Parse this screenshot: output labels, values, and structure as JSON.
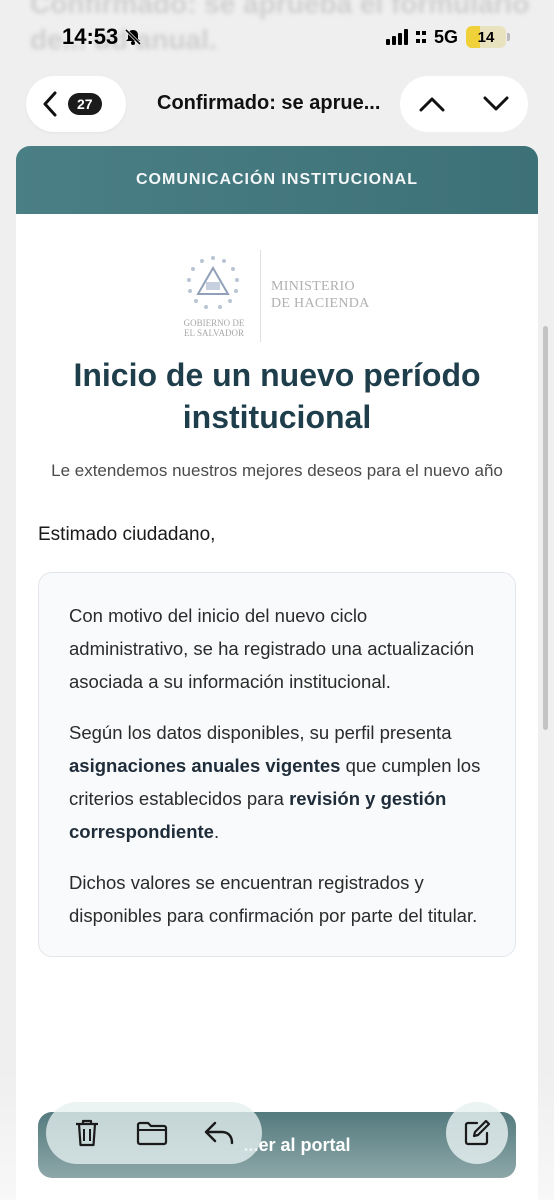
{
  "background_subject": "Confirmado: se aprueba el formulario de... ud anual.",
  "status_bar": {
    "time": "14:53",
    "network": "5G",
    "battery": "14"
  },
  "nav": {
    "unread_count": "27",
    "title": "Confirmado: se aprue..."
  },
  "email": {
    "banner": "COMUNICACIÓN INSTITUCIONAL",
    "logo": {
      "gov_line1": "GOBIERNO DE",
      "gov_line2": "EL SALVADOR",
      "ministry_line1": "MINISTERIO",
      "ministry_line2": "DE HACIENDA"
    },
    "headline": "Inicio de un nuevo período institucional",
    "subtitle": "Le extendemos nuestros mejores deseos para el nuevo año",
    "greeting": "Estimado ciudadano,",
    "p1": "Con motivo del inicio del nuevo ciclo administrativo, se ha registrado una actualización asociada a su información institucional.",
    "p2_a": "Según los datos disponibles, su perfil presenta ",
    "p2_b": "asignaciones anuales vigentes",
    "p2_c": " que cumplen los criterios establecidos para ",
    "p2_d": "revisión y gestión correspondiente",
    "p2_e": ".",
    "p3": "Dichos valores se encuentran registrados y disponibles para confirmación por parte del titular.",
    "portal_button": "...er al portal"
  },
  "colors": {
    "banner": "#3d7178",
    "headline": "#1f3e4c",
    "portal_button": "#2f5e62"
  }
}
